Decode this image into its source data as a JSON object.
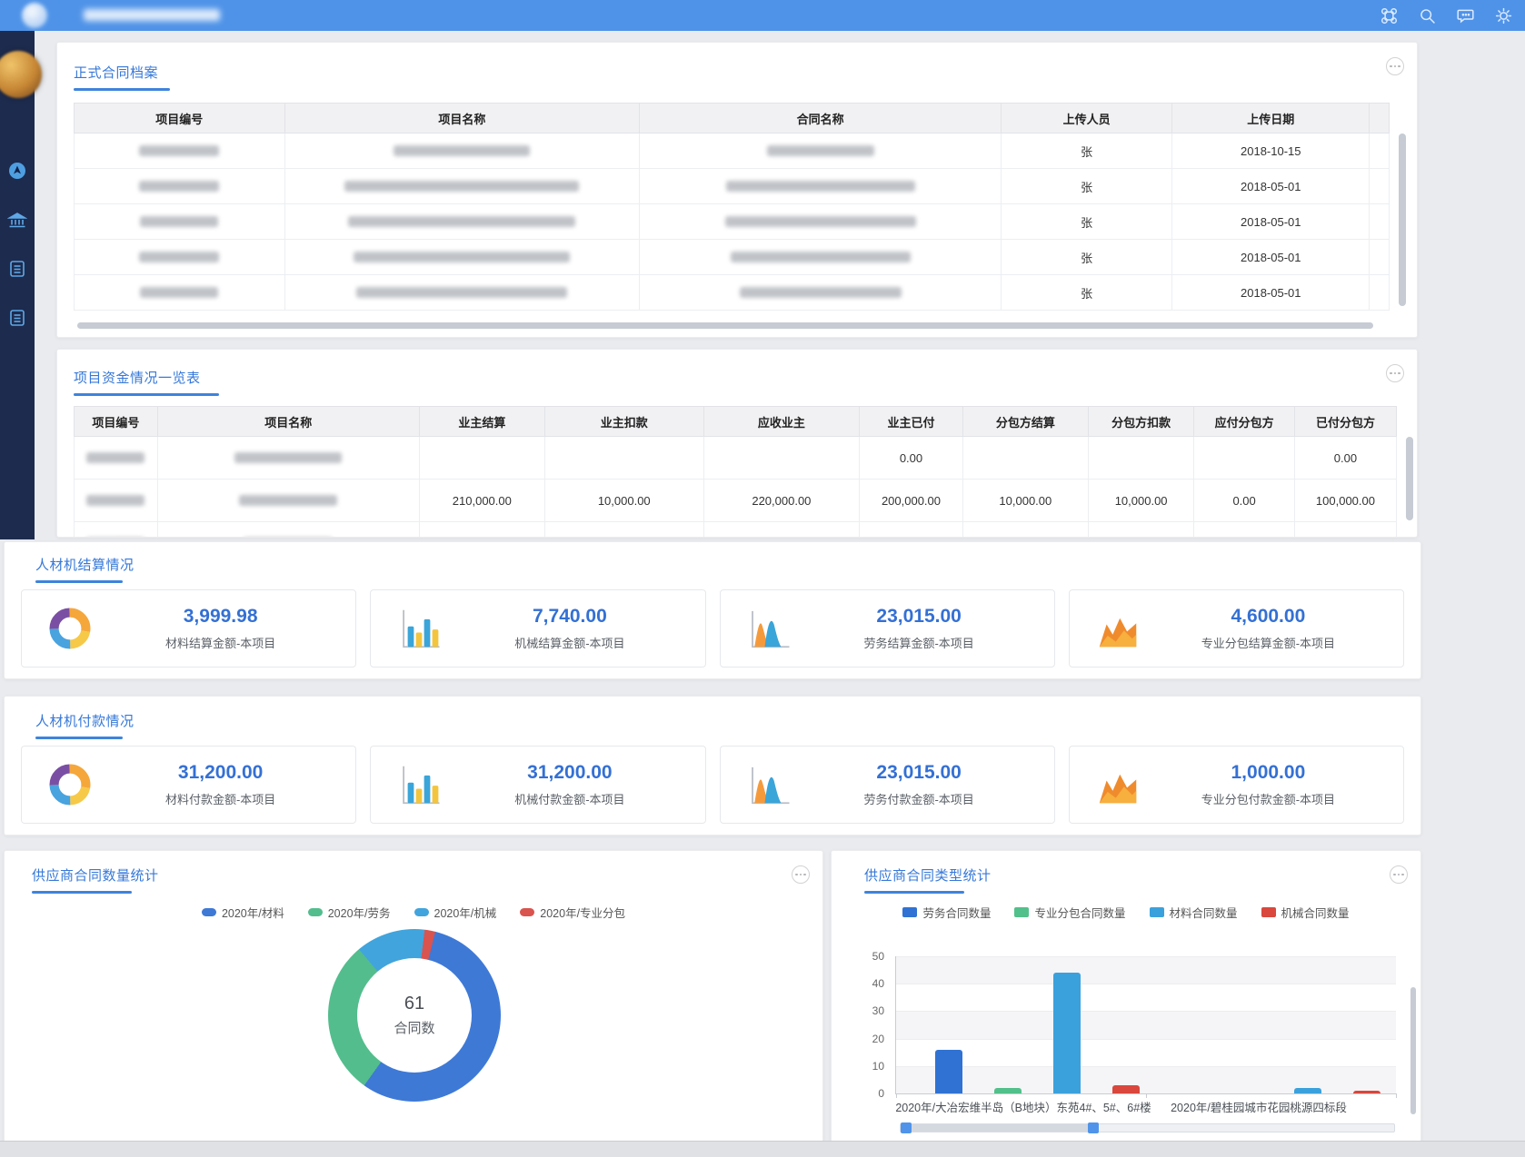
{
  "header": {
    "bg_color": "#4f93e8",
    "icons": [
      "command-grid-icon",
      "search-icon",
      "message-icon",
      "settings-icon"
    ]
  },
  "sidebar": {
    "icons": [
      "compass-icon",
      "bank-icon",
      "document-icon",
      "document-icon"
    ]
  },
  "contracts": {
    "title": "正式合同档案",
    "table": {
      "headers": [
        "项目编号",
        "项目名称",
        "合同名称",
        "上传人员",
        "上传日期"
      ],
      "rows": [
        {
          "uploader": "张",
          "date": "2018-10-15"
        },
        {
          "uploader": "张",
          "date": "2018-05-01"
        },
        {
          "uploader": "张",
          "date": "2018-05-01"
        },
        {
          "uploader": "张",
          "date": "2018-05-01"
        },
        {
          "uploader": "张",
          "date": "2018-05-01"
        }
      ]
    }
  },
  "funds": {
    "title": "项目资金情况一览表",
    "table": {
      "headers": [
        "项目编号",
        "项目名称",
        "业主结算",
        "业主扣款",
        "应收业主",
        "业主已付",
        "分包方结算",
        "分包方扣款",
        "应付分包方",
        "已付分包方"
      ],
      "rows": [
        {
          "values": [
            "",
            "",
            "",
            "0.00",
            "",
            "",
            "",
            "0.00"
          ]
        },
        {
          "values": [
            "210,000.00",
            "10,000.00",
            "220,000.00",
            "200,000.00",
            "10,000.00",
            "10,000.00",
            "0.00",
            "100,000.00"
          ]
        }
      ]
    }
  },
  "settlement": {
    "title": "人材机结算情况",
    "cards": [
      {
        "icon": "donut-chart-icon",
        "value": "3,999.98",
        "label": "材料结算金额-本项目"
      },
      {
        "icon": "bar-chart-icon",
        "value": "7,740.00",
        "label": "机械结算金额-本项目"
      },
      {
        "icon": "peaks-chart-icon",
        "value": "23,015.00",
        "label": "劳务结算金额-本项目"
      },
      {
        "icon": "mountain-chart-icon",
        "value": "4,600.00",
        "label": "专业分包结算金额-本项目"
      }
    ]
  },
  "payment": {
    "title": "人材机付款情况",
    "cards": [
      {
        "icon": "donut-chart-icon",
        "value": "31,200.00",
        "label": "材料付款金额-本项目"
      },
      {
        "icon": "bar-chart-icon",
        "value": "31,200.00",
        "label": "机械付款金额-本项目"
      },
      {
        "icon": "peaks-chart-icon",
        "value": "23,015.00",
        "label": "劳务付款金额-本项目"
      },
      {
        "icon": "mountain-chart-icon",
        "value": "1,000.00",
        "label": "专业分包付款金额-本项目"
      }
    ]
  },
  "supplier_count": {
    "title": "供应商合同数量统计",
    "chart_data": {
      "type": "pie",
      "center_value": "61",
      "center_label": "合同数",
      "start_angle": -40,
      "legend": [
        "2020年/材料",
        "2020年/劳务",
        "2020年/机械",
        "2020年/专业分包"
      ],
      "segments": [
        {
          "name": "2020年/机械",
          "pct": 13,
          "color": "#41a4dc"
        },
        {
          "name": "2020年/专业分包",
          "pct": 2,
          "color": "#d9534f"
        },
        {
          "name": "2020年/材料",
          "pct": 56,
          "color": "#3e79d6"
        },
        {
          "name": "2020年/劳务",
          "pct": 29,
          "color": "#53bd8d"
        }
      ]
    }
  },
  "supplier_type": {
    "title": "供应商合同类型统计",
    "chart_data": {
      "type": "bar",
      "categories": [
        "2020年/大冶宏维半岛（B地块）东苑4#、5#、6#楼",
        "2020年/碧桂园城市花园桃源四标段"
      ],
      "series": [
        {
          "name": "劳务合同数量",
          "color": "#2f72d3",
          "values": [
            16,
            0
          ]
        },
        {
          "name": "专业分包合同数量",
          "color": "#52c08a",
          "values": [
            2,
            0
          ]
        },
        {
          "name": "材料合同数量",
          "color": "#3ba1dc",
          "values": [
            44,
            2
          ]
        },
        {
          "name": "机械合同数量",
          "color": "#d9473d",
          "values": [
            3,
            1
          ]
        }
      ],
      "ylim": [
        0,
        50
      ],
      "ytick_step": 10,
      "grid": true,
      "legend_position": "top"
    }
  }
}
